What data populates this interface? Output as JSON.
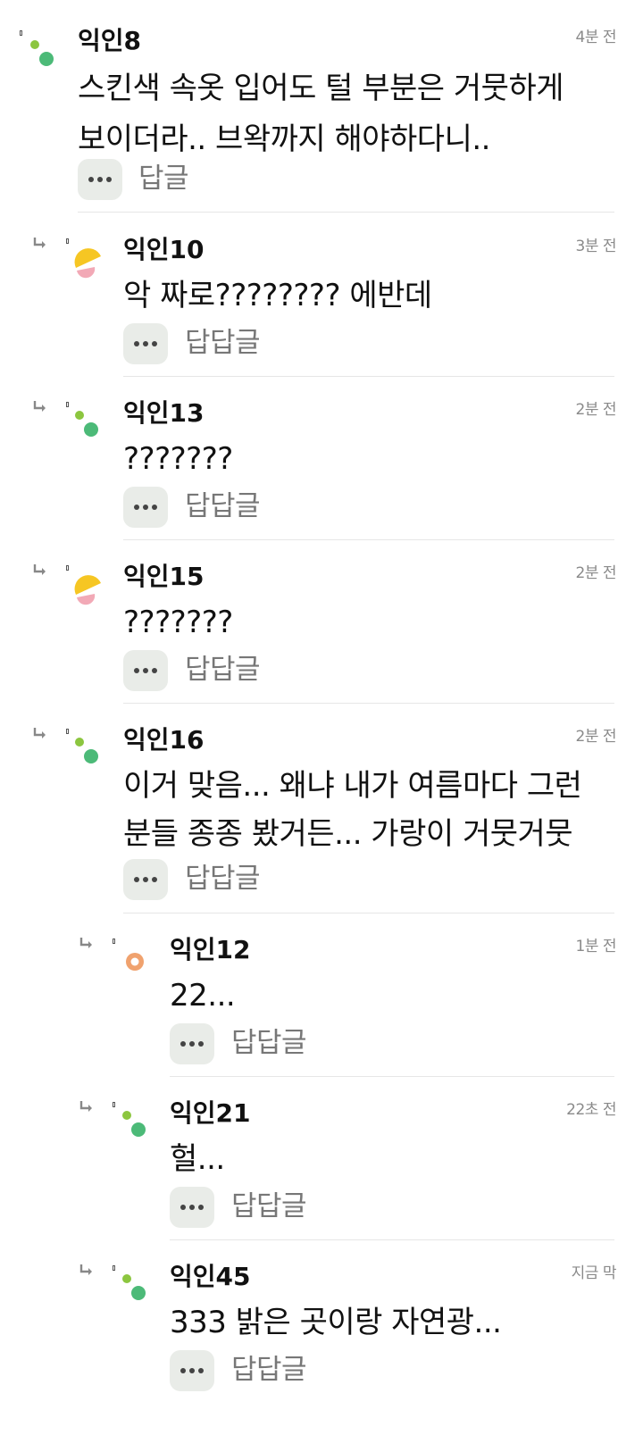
{
  "comments": [
    {
      "author": "익인8",
      "time": "4분 전",
      "lines": [
        "스킨색 속옷 입어도 털 부분은 거뭇하게",
        "보이더라.. 브왁까지 해야하다니.."
      ],
      "reply_label": "답글",
      "avatar": "green-dots",
      "is_reply": false
    },
    {
      "author": "익인10",
      "time": "3분 전",
      "lines": [
        "악 짜로???????? 에반데"
      ],
      "reply_label": "답답글",
      "avatar": "yellow-pink",
      "is_reply": true
    },
    {
      "author": "익인13",
      "time": "2분 전",
      "lines": [
        "???????"
      ],
      "reply_label": "답답글",
      "avatar": "green-dots",
      "is_reply": true
    },
    {
      "author": "익인15",
      "time": "2분 전",
      "lines": [
        "???????"
      ],
      "reply_label": "답답글",
      "avatar": "yellow-pink",
      "is_reply": true
    },
    {
      "author": "익인16",
      "time": "2분 전",
      "lines": [
        "이거 맞음... 왜냐 내가 여름마다 그런",
        "분들 종종 봤거든... 가랑이 거뭇거뭇"
      ],
      "reply_label": "답답글",
      "avatar": "green-dots",
      "is_reply": true
    },
    {
      "author": "익인12",
      "time": "1분 전",
      "lines": [
        "22..."
      ],
      "reply_label": "답답글",
      "avatar": "orange-ring",
      "is_reply": true
    },
    {
      "author": "익인21",
      "time": "22초 전",
      "lines": [
        "헐..."
      ],
      "reply_label": "답답글",
      "avatar": "green-dots",
      "is_reply": true
    },
    {
      "author": "익인45",
      "time": "지금 막",
      "lines": [
        "333 밝은 곳이랑 자연광..."
      ],
      "reply_label": "답답글",
      "avatar": "green-dots",
      "is_reply": true
    }
  ],
  "colors": {
    "accent_green": "#4cba78",
    "light_green": "#8cc63f",
    "yellow": "#f6c623",
    "pink": "#f2a9b6",
    "orange": "#f0a26e",
    "reply_bg": "#e9ece8"
  }
}
